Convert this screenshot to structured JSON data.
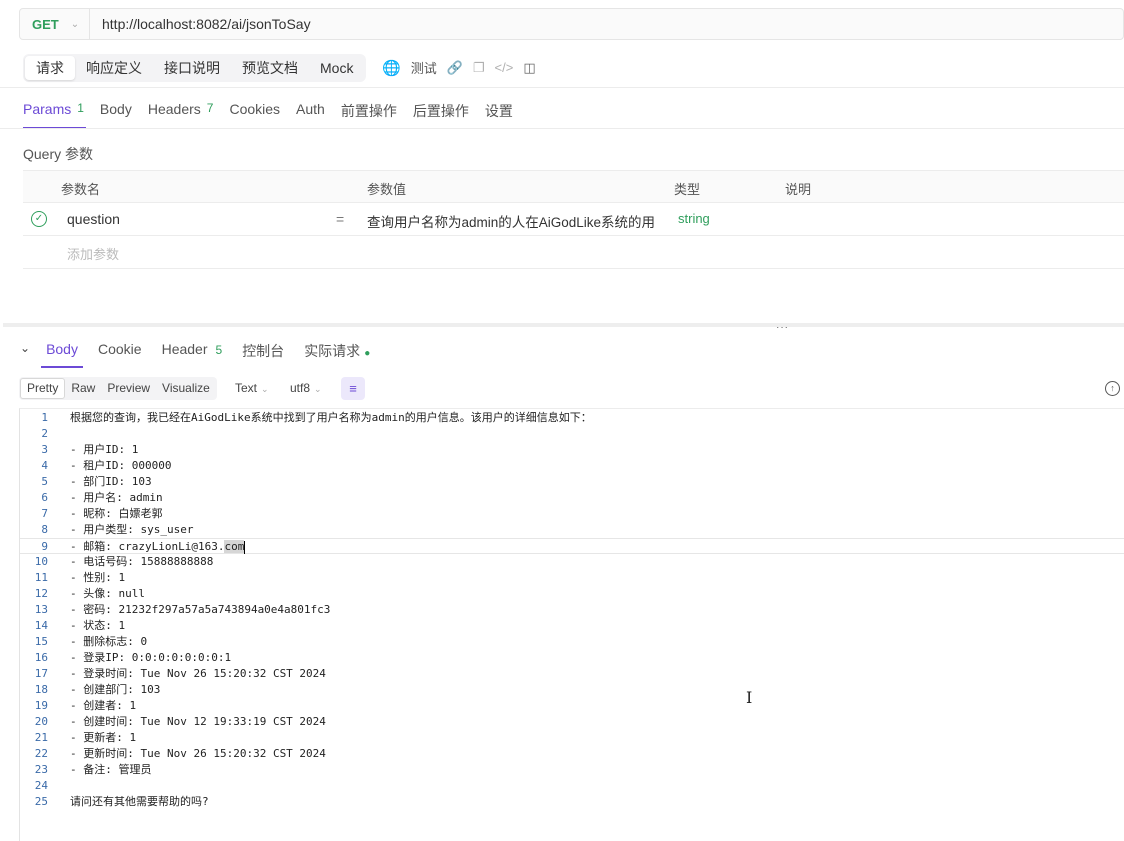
{
  "request": {
    "method": "GET",
    "url": "http://localhost:8082/ai/jsonToSay"
  },
  "top_tabs": [
    "请求",
    "响应定义",
    "接口说明",
    "预览文档",
    "Mock"
  ],
  "test_label": "测试",
  "param_tabs": [
    {
      "label": "Params",
      "count": "1"
    },
    {
      "label": "Body",
      "count": ""
    },
    {
      "label": "Headers",
      "count": "7"
    },
    {
      "label": "Cookies",
      "count": ""
    },
    {
      "label": "Auth",
      "count": ""
    },
    {
      "label": "前置操作",
      "count": ""
    },
    {
      "label": "后置操作",
      "count": ""
    },
    {
      "label": "设置",
      "count": ""
    }
  ],
  "query": {
    "title": "Query 参数",
    "columns": [
      "参数名",
      "参数值",
      "类型",
      "说明"
    ],
    "rows": [
      {
        "name": "question",
        "eq": "=",
        "value": "查询用户名称为admin的人在AiGodLike系统的用",
        "type": "string",
        "desc": ""
      }
    ],
    "add_placeholder": "添加参数"
  },
  "splitter": "...",
  "response_tabs": [
    {
      "label": "Body",
      "count": ""
    },
    {
      "label": "Cookie",
      "count": ""
    },
    {
      "label": "Header",
      "count": "5"
    },
    {
      "label": "控制台",
      "count": ""
    },
    {
      "label": "实际请求",
      "count": ""
    }
  ],
  "view_modes": [
    "Pretty",
    "Raw",
    "Preview",
    "Visualize"
  ],
  "format_select": "Text",
  "encoding_select": "utf8",
  "body_lines": [
    "根据您的查询，我已经在AiGodLike系统中找到了用户名称为admin的用户信息。该用户的详细信息如下：",
    "",
    "- 用户ID: 1",
    "- 租户ID: 000000",
    "- 部门ID: 103",
    "- 用户名: admin",
    "- 昵称: 白嫖老郭",
    "- 用户类型: sys_user",
    "- 邮箱: crazyLionLi@163.",
    "- 电话号码: 15888888888",
    "- 性别: 1",
    "- 头像: null",
    "- 密码: 21232f297a57a5a743894a0e4a801fc3",
    "- 状态: 1",
    "- 删除标志: 0",
    "- 登录IP: 0:0:0:0:0:0:0:1",
    "- 登录时间: Tue Nov 26 15:20:32 CST 2024",
    "- 创建部门: 103",
    "- 创建者: 1",
    "- 创建时间: Tue Nov 12 19:33:19 CST 2024",
    "- 更新者: 1",
    "- 更新时间: Tue Nov 26 15:20:32 CST 2024",
    "- 备注: 管理员",
    "",
    "请问还有其他需要帮助的吗?"
  ],
  "line9_selected": "com",
  "accent_color": "#6c4ad6",
  "success_color": "#2f9e5c"
}
